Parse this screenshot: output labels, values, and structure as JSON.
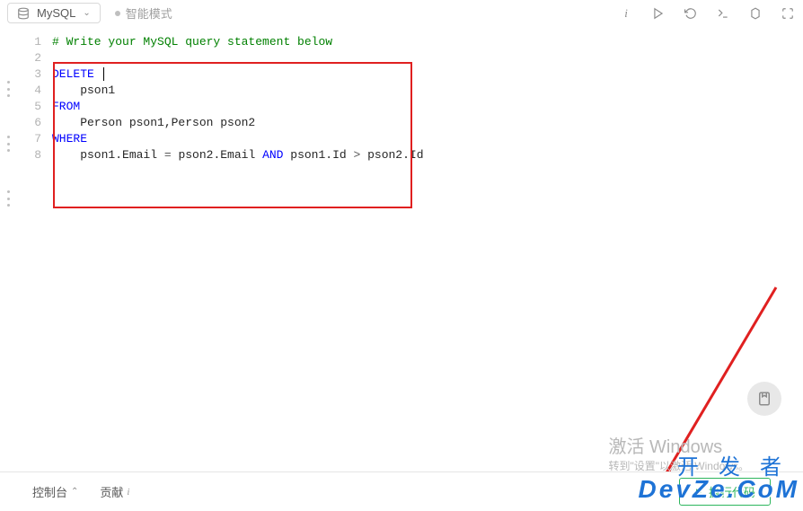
{
  "header": {
    "language": "MySQL",
    "mode_label": "智能模式"
  },
  "toolbar_icons": [
    "info",
    "play",
    "reset",
    "terminal",
    "settings",
    "fullscreen"
  ],
  "code": {
    "lines": [
      {
        "n": 1,
        "segments": [
          {
            "t": "# Write your MySQL query statement below",
            "c": "comment"
          }
        ]
      },
      {
        "n": 2,
        "segments": []
      },
      {
        "n": 3,
        "segments": [
          {
            "t": "DELETE",
            "c": "kw"
          },
          {
            "t": " ",
            "c": "op"
          }
        ],
        "cursor": true
      },
      {
        "n": 4,
        "segments": [
          {
            "t": "    pson1",
            "c": "code"
          }
        ]
      },
      {
        "n": 5,
        "segments": [
          {
            "t": "FROM",
            "c": "kw"
          }
        ]
      },
      {
        "n": 6,
        "segments": [
          {
            "t": "    Person pson1,Person pson2",
            "c": "code"
          }
        ]
      },
      {
        "n": 7,
        "segments": [
          {
            "t": "WHERE",
            "c": "kw"
          }
        ]
      },
      {
        "n": 8,
        "segments": [
          {
            "t": "    pson1.Email ",
            "c": "code"
          },
          {
            "t": "=",
            "c": "op"
          },
          {
            "t": " pson2.Email ",
            "c": "code"
          },
          {
            "t": "AND",
            "c": "kw"
          },
          {
            "t": " pson1.Id ",
            "c": "code"
          },
          {
            "t": ">",
            "c": "op"
          },
          {
            "t": " pson2.Id",
            "c": "code"
          }
        ]
      }
    ]
  },
  "bottombar": {
    "console_label": "控制台",
    "contrib_label": "贡献",
    "run_label": "执行代码"
  },
  "watermarks": {
    "windows_title": "激活 Windows",
    "windows_sub": "转到\"设置\"以激活 Windows。",
    "brand": "DevZe.CoM",
    "brand_cn": "开 发 者"
  }
}
